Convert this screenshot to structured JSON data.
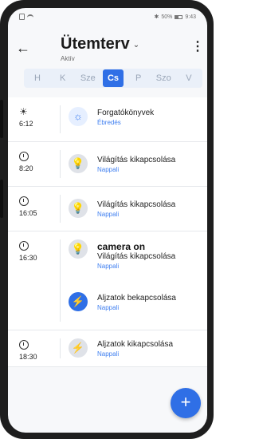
{
  "statusbar": {
    "right_text": "50%",
    "time": "9:43"
  },
  "header": {
    "title": "Ütemterv",
    "subtitle": "Aktív"
  },
  "days": [
    "H",
    "K",
    "Sze",
    "Cs",
    "P",
    "Szo",
    "V"
  ],
  "active_day": "Cs",
  "schedule": [
    {
      "time": "6:12",
      "time_icon": "sunrise-icon",
      "items": [
        {
          "title": "Forgatókönyvek",
          "sub": "Ébredés",
          "icon": "sun-icon"
        }
      ]
    },
    {
      "time": "8:20",
      "time_icon": "clock-icon",
      "items": [
        {
          "title": "Világítás kikapcsolása",
          "sub": "Nappali",
          "icon": "bulb-icon"
        }
      ]
    },
    {
      "time": "16:05",
      "time_icon": "clock-icon",
      "items": [
        {
          "title": "Világítás kikapcsolása",
          "sub": "Nappali",
          "icon": "bulb-icon"
        }
      ]
    },
    {
      "time": "16:30",
      "time_icon": "clock-icon",
      "items": [
        {
          "heading": "camera on",
          "title": "Világítás kikapcsolása",
          "sub": "Nappali",
          "icon": "bulb-icon"
        },
        {
          "title": "Aljzatok bekapcsolása",
          "sub": "Nappali",
          "icon": "bolt-icon"
        }
      ]
    },
    {
      "time": "18:30",
      "time_icon": "clock-icon",
      "items": [
        {
          "title": "Aljzatok kikapcsolása",
          "sub": "Nappali",
          "icon": "bolt-icon"
        }
      ]
    }
  ],
  "fab": {
    "label": "+"
  },
  "colors": {
    "accent": "#2f6fe6",
    "sub_text": "#3f7ff0",
    "frame": "#1e1e1e"
  }
}
